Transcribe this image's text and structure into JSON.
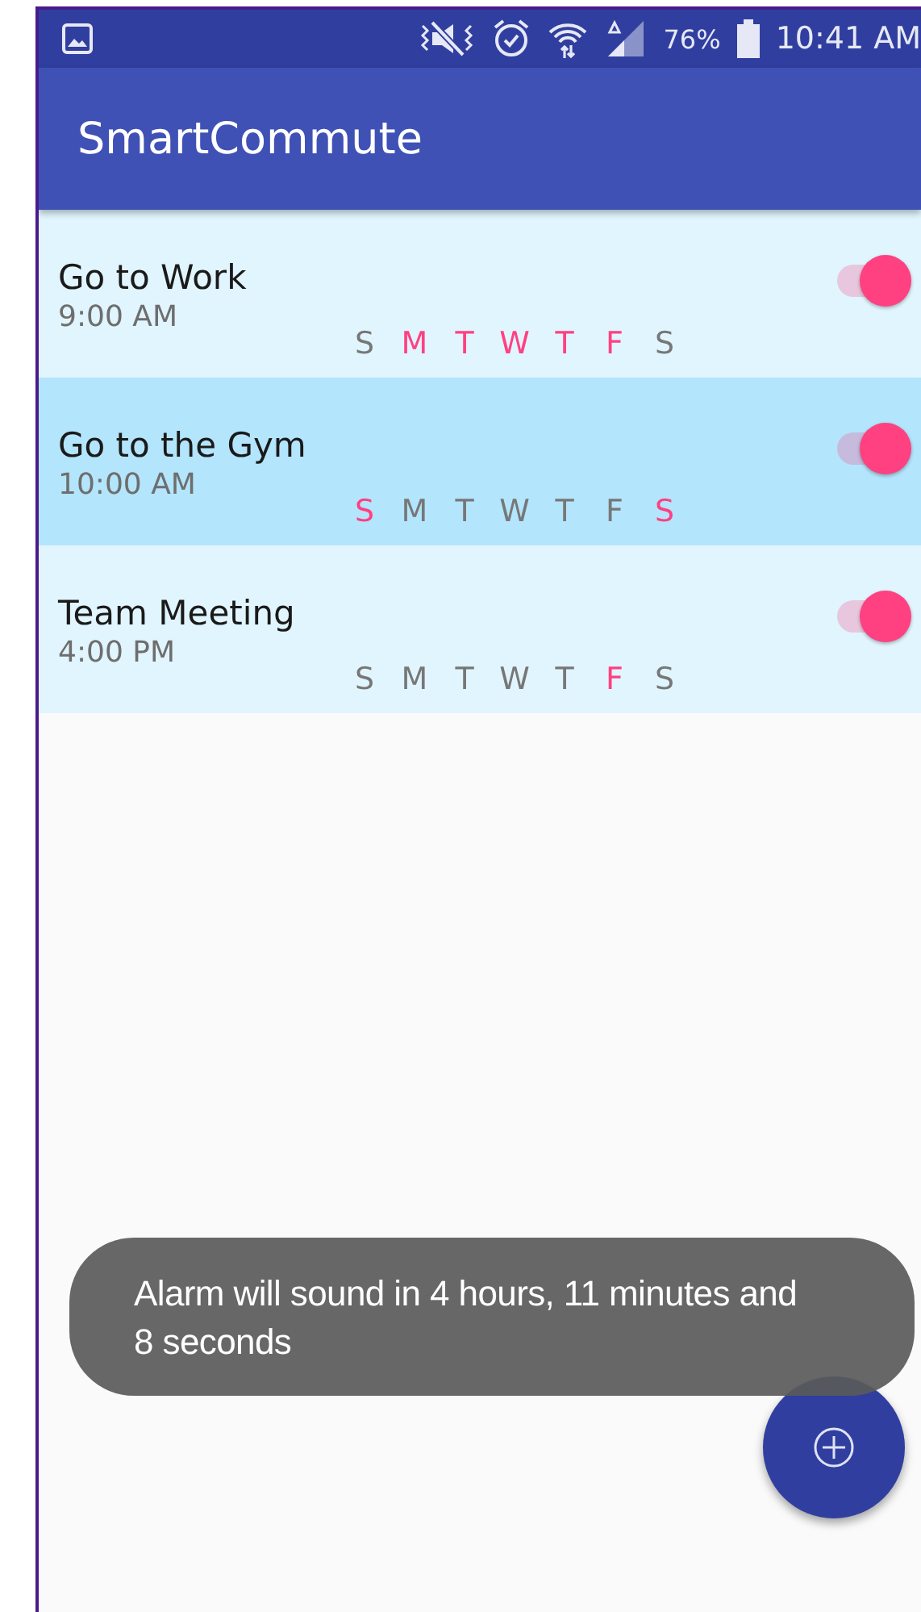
{
  "status_bar": {
    "battery": "76%",
    "time": "10:41 AM"
  },
  "app_bar": {
    "title": "SmartCommute"
  },
  "alarms": [
    {
      "name": "Go to Work",
      "time": "9:00 AM",
      "selected": false,
      "on": true,
      "days": [
        {
          "letter": "S",
          "on": false
        },
        {
          "letter": "M",
          "on": true
        },
        {
          "letter": "T",
          "on": true
        },
        {
          "letter": "W",
          "on": true
        },
        {
          "letter": "T",
          "on": true
        },
        {
          "letter": "F",
          "on": true
        },
        {
          "letter": "S",
          "on": false
        }
      ]
    },
    {
      "name": "Go to the Gym",
      "time": "10:00 AM",
      "selected": true,
      "on": true,
      "days": [
        {
          "letter": "S",
          "on": true
        },
        {
          "letter": "M",
          "on": false
        },
        {
          "letter": "T",
          "on": false
        },
        {
          "letter": "W",
          "on": false
        },
        {
          "letter": "T",
          "on": false
        },
        {
          "letter": "F",
          "on": false
        },
        {
          "letter": "S",
          "on": true
        }
      ]
    },
    {
      "name": "Team Meeting",
      "time": "4:00 PM",
      "selected": false,
      "on": true,
      "days": [
        {
          "letter": "S",
          "on": false
        },
        {
          "letter": "M",
          "on": false
        },
        {
          "letter": "T",
          "on": false
        },
        {
          "letter": "W",
          "on": false
        },
        {
          "letter": "T",
          "on": false
        },
        {
          "letter": "F",
          "on": true
        },
        {
          "letter": "S",
          "on": false
        }
      ]
    }
  ],
  "toast": {
    "message": "Alarm will sound in 4 hours, 11 minutes and 8 seconds"
  }
}
